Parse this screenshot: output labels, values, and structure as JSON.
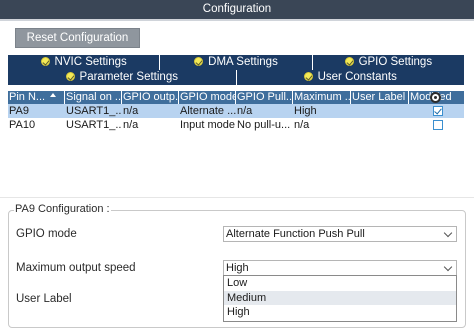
{
  "window": {
    "title": "Configuration"
  },
  "toolbar": {
    "reset_label": "Reset Configuration"
  },
  "tabs_row1": [
    {
      "label": "NVIC Settings",
      "active": false
    },
    {
      "label": "DMA Settings",
      "active": false
    },
    {
      "label": "GPIO Settings",
      "active": true
    }
  ],
  "tabs_row2": [
    {
      "label": "Parameter Settings"
    },
    {
      "label": "User Constants"
    }
  ],
  "table": {
    "headers": [
      "Pin N...",
      "Signal on ...",
      "GPIO outp...",
      "GPIO mode",
      "GPIO Pull...",
      "Maximum ...",
      "User Label",
      "Modified"
    ],
    "rows": [
      {
        "pin": "PA9",
        "signal": "USART1_...",
        "output": "n/a",
        "mode": "Alternate ...",
        "pull": "n/a",
        "speed": "High",
        "label": "",
        "modified": true
      },
      {
        "pin": "PA10",
        "signal": "USART1_...",
        "output": "n/a",
        "mode": "Input mode",
        "pull": "No pull-u...",
        "speed": "n/a",
        "label": "",
        "modified": false
      }
    ]
  },
  "config": {
    "group_title": "PA9 Configuration :",
    "gpio_mode_label": "GPIO mode",
    "gpio_mode_value": "Alternate Function Push Pull",
    "max_speed_label": "Maximum output speed",
    "max_speed_value": "High",
    "user_label_label": "User Label",
    "speed_options": [
      "Low",
      "Medium",
      "High"
    ]
  }
}
